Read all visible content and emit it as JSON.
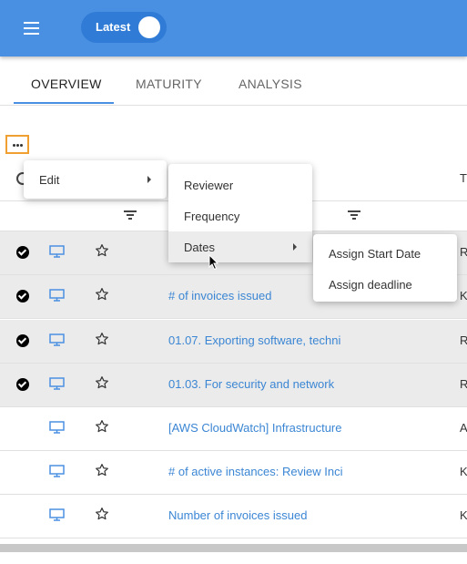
{
  "header": {
    "menu_icon": "hamburger-menu-icon",
    "toggle_label": "Latest",
    "brand_color": "#4a90e2"
  },
  "tabs": [
    {
      "label": "OVERVIEW",
      "active": true
    },
    {
      "label": "MATURITY",
      "active": false
    },
    {
      "label": "ANALYSIS",
      "active": false
    }
  ],
  "toolbar": {
    "more_icon": "more-horizontal-icon"
  },
  "table": {
    "header_last_col": "T",
    "rows": [
      {
        "selected": true,
        "title": "",
        "last_col": "R"
      },
      {
        "selected": true,
        "title": "# of invoices issued",
        "last_col": "K"
      },
      {
        "selected": true,
        "title": "01.07.  Exporting software, techni",
        "last_col": "R"
      },
      {
        "selected": true,
        "title": "01.03.  For security and network",
        "last_col": "R"
      },
      {
        "selected": false,
        "title": "[AWS CloudWatch] Infrastructure",
        "last_col": "As"
      },
      {
        "selected": false,
        "title": "# of active instances: Review Inci",
        "last_col": "K"
      },
      {
        "selected": false,
        "title": "Number of invoices issued",
        "last_col": "K"
      }
    ]
  },
  "context_menu": {
    "level1": [
      {
        "label": "Edit",
        "has_submenu": true
      }
    ],
    "level2": [
      {
        "label": "Reviewer",
        "has_submenu": false
      },
      {
        "label": "Frequency",
        "has_submenu": false
      },
      {
        "label": "Dates",
        "has_submenu": true,
        "highlighted": true
      }
    ],
    "level3": [
      {
        "label": "Assign Start Date",
        "has_submenu": false
      },
      {
        "label": "Assign deadline",
        "has_submenu": false
      }
    ]
  }
}
